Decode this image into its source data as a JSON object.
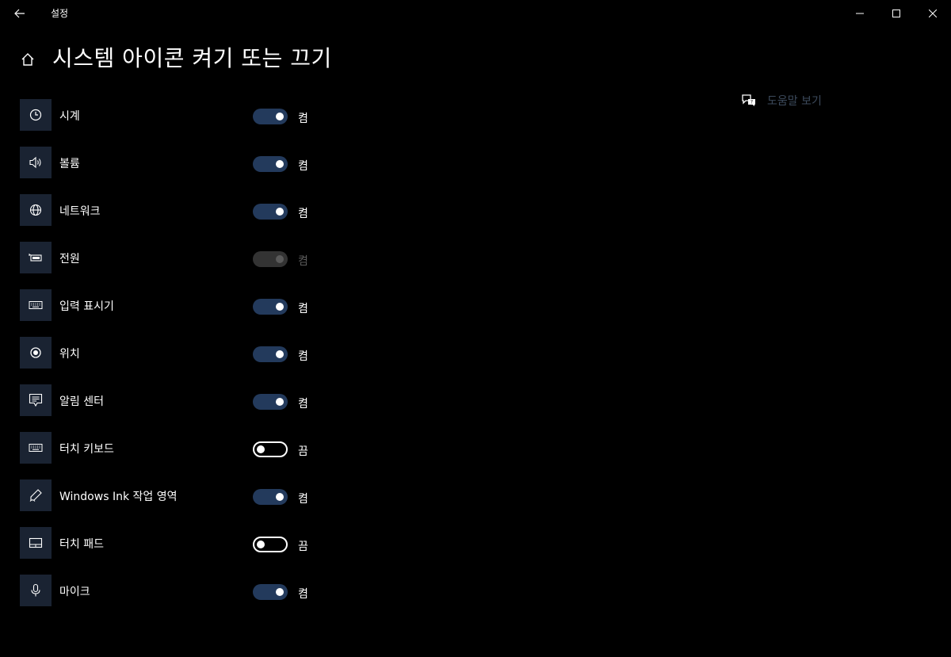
{
  "window": {
    "app_title": "설정"
  },
  "header": {
    "title": "시스템 아이콘 켜기 또는 끄기"
  },
  "help": {
    "label": "도움말 보기"
  },
  "settings": [
    {
      "label": "시계",
      "icon": "clock-icon",
      "state": "켬",
      "on": true,
      "disabled": false
    },
    {
      "label": "볼륨",
      "icon": "volume-icon",
      "state": "켬",
      "on": true,
      "disabled": false
    },
    {
      "label": "네트워크",
      "icon": "globe-icon",
      "state": "켬",
      "on": true,
      "disabled": false
    },
    {
      "label": "전원",
      "icon": "battery-icon",
      "state": "켬",
      "on": true,
      "disabled": true
    },
    {
      "label": "입력 표시기",
      "icon": "keyboard-icon",
      "state": "켬",
      "on": true,
      "disabled": false
    },
    {
      "label": "위치",
      "icon": "location-icon",
      "state": "켬",
      "on": true,
      "disabled": false
    },
    {
      "label": "알림 센터",
      "icon": "action-center-icon",
      "state": "켬",
      "on": true,
      "disabled": false
    },
    {
      "label": "터치 키보드",
      "icon": "touch-keyboard-icon",
      "state": "끔",
      "on": false,
      "disabled": false
    },
    {
      "label": "Windows Ink 작업 영역",
      "icon": "pen-icon",
      "state": "켬",
      "on": true,
      "disabled": false
    },
    {
      "label": "터치 패드",
      "icon": "touchpad-icon",
      "state": "끔",
      "on": false,
      "disabled": false
    },
    {
      "label": "마이크",
      "icon": "microphone-icon",
      "state": "켬",
      "on": true,
      "disabled": false
    }
  ],
  "colors": {
    "background": "#000000",
    "icon_tile": "#1a2332",
    "toggle_on": "#233a5c",
    "toggle_disabled": "#333333",
    "help_text": "#3c4a5c"
  }
}
